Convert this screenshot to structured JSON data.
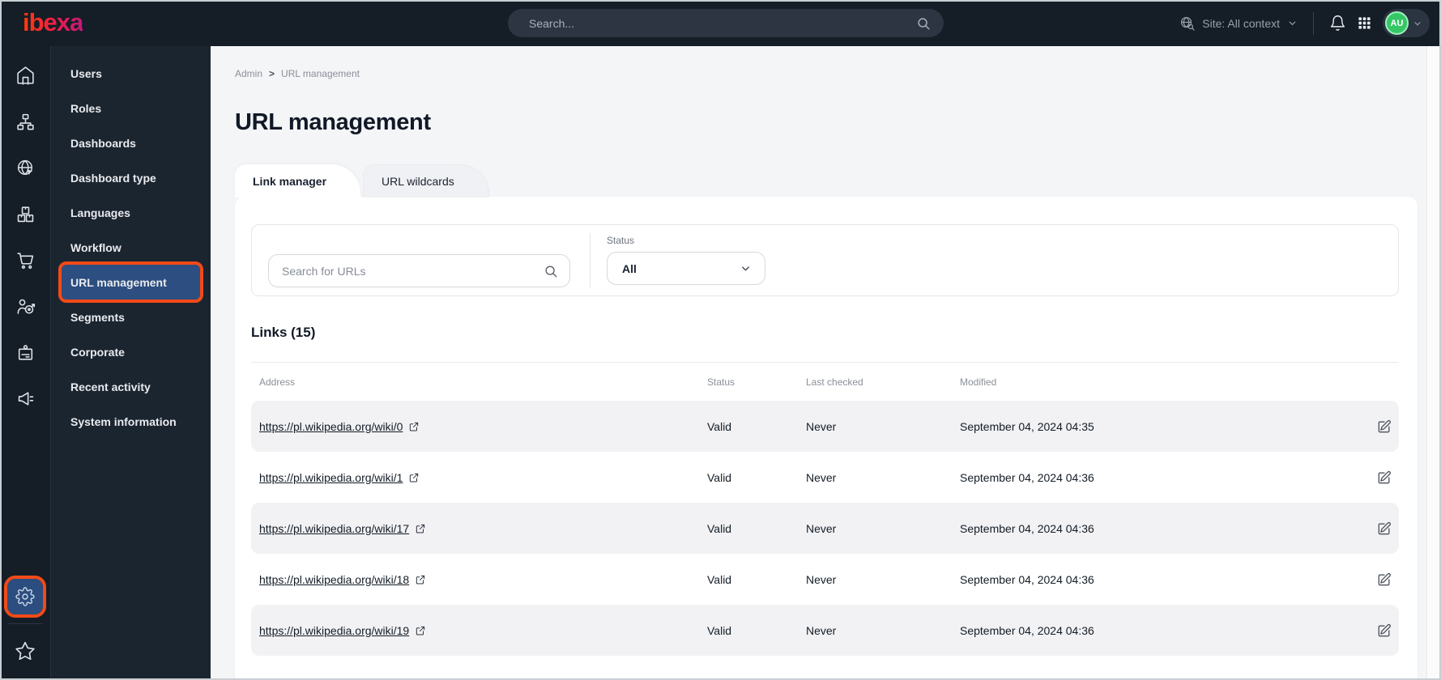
{
  "topbar": {
    "logo_text": "ibexa",
    "search_placeholder": "Search...",
    "site_context_label": "Site: All context",
    "avatar_initials": "AU"
  },
  "sidebar": {
    "rail_icons": [
      "home-icon",
      "site-tree-icon",
      "website-globe-icon",
      "product-catalog-icon",
      "cart-icon",
      "personalization-target-icon",
      "company-badge-icon",
      "campaign-megaphone-icon",
      "settings-gear-icon",
      "favorites-star-icon"
    ],
    "menu_items": [
      {
        "label": "Users",
        "active": false
      },
      {
        "label": "Roles",
        "active": false
      },
      {
        "label": "Dashboards",
        "active": false
      },
      {
        "label": "Dashboard type",
        "active": false
      },
      {
        "label": "Languages",
        "active": false
      },
      {
        "label": "Workflow",
        "active": false
      },
      {
        "label": "URL management",
        "active": true
      },
      {
        "label": "Segments",
        "active": false
      },
      {
        "label": "Corporate",
        "active": false
      },
      {
        "label": "Recent activity",
        "active": false
      },
      {
        "label": "System information",
        "active": false
      }
    ]
  },
  "breadcrumb": {
    "root": "Admin",
    "separator": ">",
    "current": "URL management"
  },
  "page": {
    "title": "URL management"
  },
  "tabs": [
    {
      "label": "Link manager",
      "active": true
    },
    {
      "label": "URL wildcards",
      "active": false
    }
  ],
  "filters": {
    "search_placeholder": "Search for URLs",
    "status_label": "Status",
    "status_value": "All"
  },
  "links": {
    "heading": "Links (15)"
  },
  "table": {
    "columns": [
      "Address",
      "Status",
      "Last checked",
      "Modified"
    ],
    "rows": [
      {
        "address": "https://pl.wikipedia.org/wiki/0",
        "status": "Valid",
        "last_checked": "Never",
        "modified": "September 04, 2024 04:35"
      },
      {
        "address": "https://pl.wikipedia.org/wiki/1",
        "status": "Valid",
        "last_checked": "Never",
        "modified": "September 04, 2024 04:36"
      },
      {
        "address": "https://pl.wikipedia.org/wiki/17",
        "status": "Valid",
        "last_checked": "Never",
        "modified": "September 04, 2024 04:36"
      },
      {
        "address": "https://pl.wikipedia.org/wiki/18",
        "status": "Valid",
        "last_checked": "Never",
        "modified": "September 04, 2024 04:36"
      },
      {
        "address": "https://pl.wikipedia.org/wiki/19",
        "status": "Valid",
        "last_checked": "Never",
        "modified": "September 04, 2024 04:36"
      }
    ]
  },
  "colors": {
    "topbar_bg": "#151d27",
    "menu_bg": "#1b2530",
    "active_blue": "#2c4e80",
    "annotation_orange": "#f24a18",
    "avatar_green": "#35c766",
    "content_bg": "#f4f5f7",
    "shaded_row": "#f2f2f4",
    "link_text": "#131c26"
  }
}
